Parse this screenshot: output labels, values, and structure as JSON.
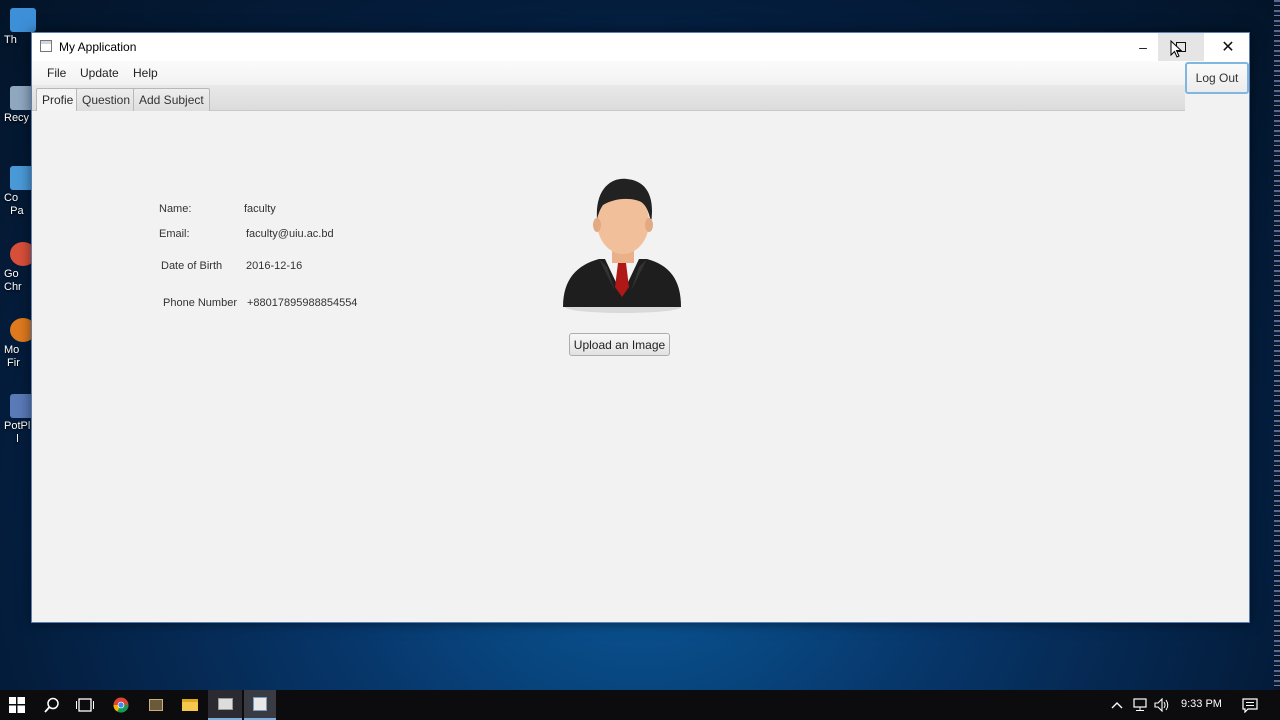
{
  "desktop": {
    "icons": [
      {
        "name": "this-pc",
        "label": "Th",
        "color": "#3d8fd8"
      },
      {
        "name": "recycle-bin",
        "label": "Recy",
        "color": "#8fa8c0"
      },
      {
        "name": "control-panel",
        "label": "Co\n  Pa",
        "color": "#4a9ad8"
      },
      {
        "name": "google-chrome",
        "label": "Go\nChr",
        "color": "#d8503a"
      },
      {
        "name": "mozilla-firefox",
        "label": "Mo\n Fir",
        "color": "#e07a20"
      },
      {
        "name": "potplayer",
        "label": "PotPl\n    l",
        "color": "#5a7ab8"
      }
    ]
  },
  "window": {
    "title": "My Application",
    "controls": {
      "minimize": "–",
      "close": "✕"
    }
  },
  "menu": [
    "File",
    "Update",
    "Help"
  ],
  "tabs": [
    {
      "label": "Profie",
      "active": true
    },
    {
      "label": "Question",
      "active": false
    },
    {
      "label": "Add Subject",
      "active": false
    }
  ],
  "logout_label": "Log Out",
  "profile": {
    "fields": [
      {
        "label": "Name:",
        "value": "faculty"
      },
      {
        "label": "Email:",
        "value": "faculty@uiu.ac.bd"
      },
      {
        "label": "Date of Birth",
        "value": "2016-12-16"
      },
      {
        "label": "Phone Number",
        "value": "+88017895988854554"
      }
    ],
    "upload_label": "Upload an Image"
  },
  "taskbar": {
    "clock": "9:33 PM",
    "pinned": [
      "start-icon",
      "search-icon",
      "task-view-icon",
      "chrome-icon",
      "app-icon",
      "file-explorer-icon",
      "window-app-icon",
      "java-app-icon"
    ]
  },
  "colors": {
    "accent": "#7fb7e0",
    "window_bg": "#f2f2f2"
  }
}
